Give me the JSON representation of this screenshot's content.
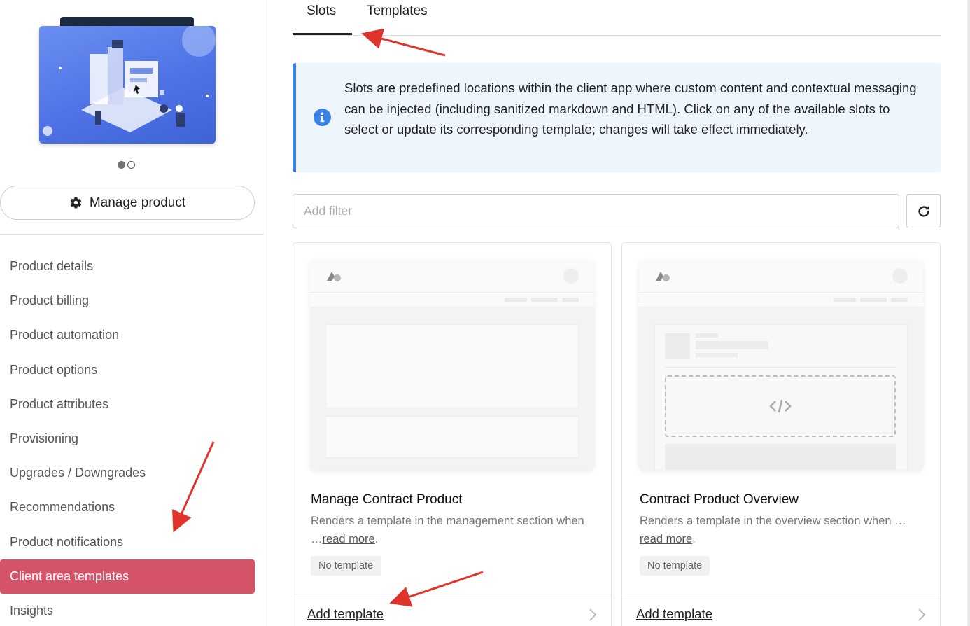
{
  "sidebar": {
    "manage_label": "Manage product",
    "carousel_dots": 2,
    "carousel_active": 0,
    "items": [
      {
        "label": "Product details",
        "active": false
      },
      {
        "label": "Product billing",
        "active": false
      },
      {
        "label": "Product automation",
        "active": false
      },
      {
        "label": "Product options",
        "active": false
      },
      {
        "label": "Product attributes",
        "active": false
      },
      {
        "label": "Provisioning",
        "active": false
      },
      {
        "label": "Upgrades / Downgrades",
        "active": false
      },
      {
        "label": "Recommendations",
        "active": false
      },
      {
        "label": "Product notifications",
        "active": false
      },
      {
        "label": "Client area templates",
        "active": true
      },
      {
        "label": "Insights",
        "active": false
      }
    ]
  },
  "tabs": [
    {
      "label": "Slots",
      "active": true
    },
    {
      "label": "Templates",
      "active": false
    }
  ],
  "info": {
    "text": "Slots are predefined locations within the client app where custom content and contextual messaging can be injected (including sanitized markdown and HTML). Click on any of the available slots to select or update its corresponding template; changes will take effect immediately."
  },
  "filter": {
    "placeholder": "Add filter",
    "value": ""
  },
  "cards": [
    {
      "title": "Manage Contract Product",
      "desc": "Renders a template in the management section when …",
      "read_more": "read more",
      "badge": "No template",
      "action": "Add template"
    },
    {
      "title": "Contract Product Overview",
      "desc": "Renders a template in the overview section when …",
      "read_more": "read more",
      "badge": "No template",
      "action": "Add template"
    }
  ],
  "colors": {
    "active_nav": "#d5546a",
    "info_accent": "#3b82e6",
    "info_bg": "#eef5fd",
    "annotation_arrow": "#e0332b"
  }
}
